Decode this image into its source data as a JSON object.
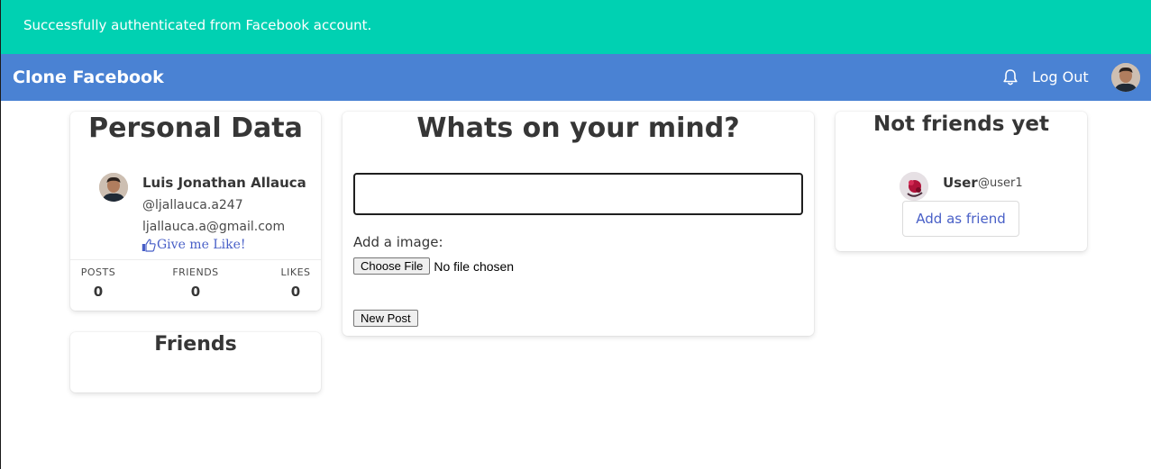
{
  "flash": {
    "message": "Successfully authenticated from Facebook account."
  },
  "navbar": {
    "brand": "Clone Facebook",
    "logout_label": "Log Out"
  },
  "personal": {
    "title": "Personal Data",
    "name": "Luis Jonathan Allauca",
    "handle": "@ljallauca.a247",
    "email": "ljallauca.a@gmail.com",
    "like_label": "Give me Like!",
    "stats": [
      {
        "label": "POSTS",
        "value": "0"
      },
      {
        "label": "FRIENDS",
        "value": "0"
      },
      {
        "label": "LIKES",
        "value": "0"
      }
    ]
  },
  "friends": {
    "title": "Friends"
  },
  "post": {
    "title": "Whats on your mind?",
    "input_value": "",
    "image_label": "Add a image:",
    "choose_file_label": "Choose File",
    "no_file_label": "No file chosen",
    "submit_label": "New Post"
  },
  "not_friends": {
    "title": "Not friends yet",
    "users": [
      {
        "name": "User",
        "handle": "@user1",
        "button_label": "Add as friend"
      }
    ]
  },
  "colors": {
    "flash_bg": "#00d1b2",
    "navbar_bg": "#4a82d3",
    "link": "#485fc7",
    "text_dark": "#363636"
  },
  "icons": {
    "notifications": "bell-icon",
    "like": "thumbs-up-icon",
    "avatar": "user-photo"
  }
}
